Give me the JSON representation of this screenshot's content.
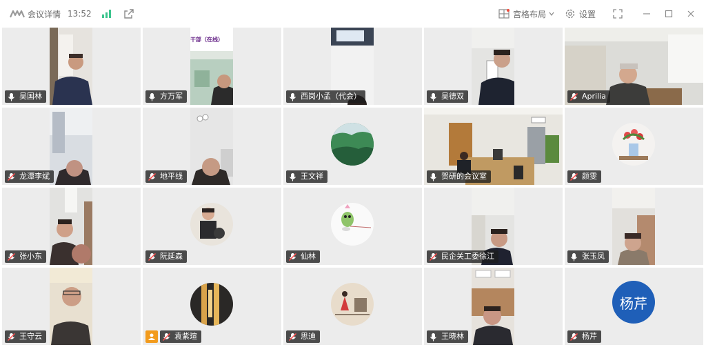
{
  "titlebar": {
    "title": "会议详情",
    "time": "13:52",
    "layout_label": "宫格布局",
    "settings_label": "设置"
  },
  "colors": {
    "accent": "#3cc48e",
    "host": "#f29b1d",
    "avatar_blue": "#1f5fb8"
  },
  "participants": [
    {
      "name": "吴国林",
      "mic": "on"
    },
    {
      "name": "方万军",
      "mic": "on"
    },
    {
      "name": "西岗小孟（代会）",
      "mic": "on"
    },
    {
      "name": "吴德双",
      "mic": "on"
    },
    {
      "name": "Aprilia",
      "mic": "muted"
    },
    {
      "name": "龙潭李斌",
      "mic": "muted"
    },
    {
      "name": "地平线",
      "mic": "muted"
    },
    {
      "name": "王文祥",
      "mic": "on"
    },
    {
      "name": "贺研的会议室",
      "mic": "on",
      "active": true
    },
    {
      "name": "颜雯",
      "mic": "muted"
    },
    {
      "name": "张小东",
      "mic": "muted"
    },
    {
      "name": "阮延森",
      "mic": "muted"
    },
    {
      "name": "仙林",
      "mic": "muted"
    },
    {
      "name": "民企关工委徐江",
      "mic": "muted"
    },
    {
      "name": "张玉凤",
      "mic": "on"
    },
    {
      "name": "王守云",
      "mic": "muted"
    },
    {
      "name": "袁紫瑄",
      "mic": "muted",
      "host": true
    },
    {
      "name": "思迪",
      "mic": "muted"
    },
    {
      "name": "王晓林",
      "mic": "on"
    },
    {
      "name": "杨芹",
      "mic": "muted",
      "avatar_text": "杨芹"
    }
  ],
  "tile_banner": "干部（在线）",
  "icons": [
    "logo-icon",
    "signal-icon",
    "share-icon",
    "grid-layout-icon",
    "chevron-down-icon",
    "gear-icon",
    "fullscreen-icon",
    "minimize-icon",
    "maximize-icon",
    "close-icon",
    "mic-icon",
    "mic-muted-icon",
    "host-icon"
  ]
}
